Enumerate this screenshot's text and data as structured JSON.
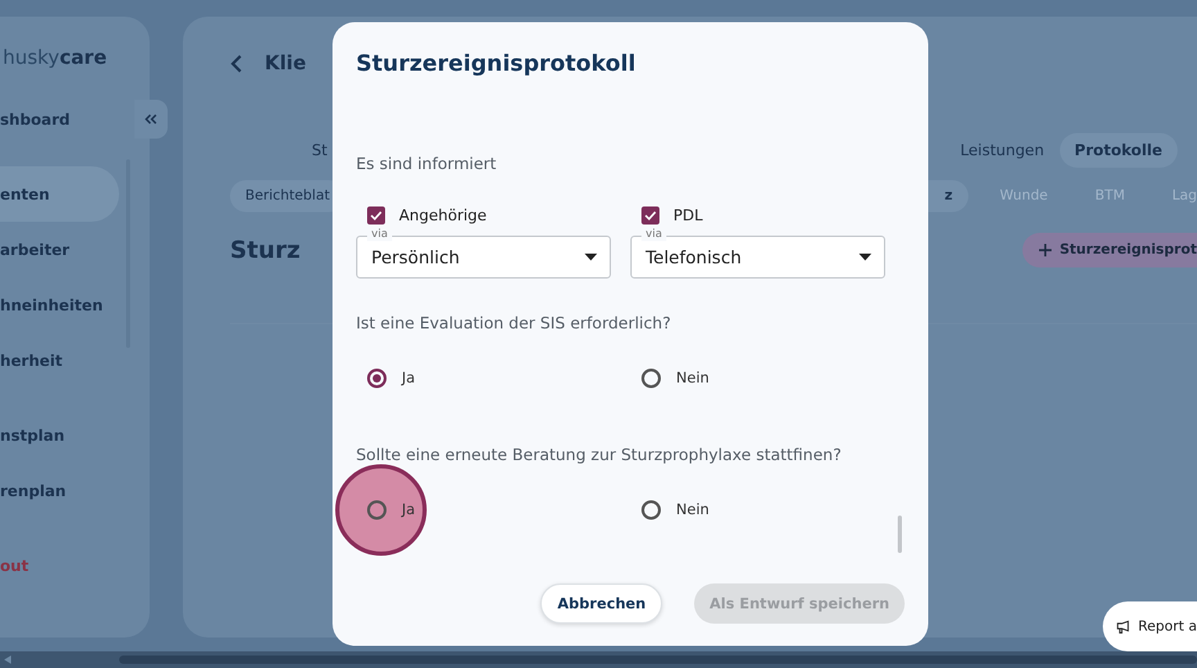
{
  "sidebar": {
    "logo": "husky**care**",
    "sections": [
      {
        "items": [
          {
            "label": "shboard",
            "selected": false,
            "kind": "nav"
          }
        ]
      },
      {
        "items": [
          {
            "label": "enten",
            "selected": true,
            "kind": "nav"
          },
          {
            "label": "arbeiter",
            "selected": false,
            "kind": "nav"
          },
          {
            "label": "hneinheiten",
            "selected": false,
            "kind": "nav"
          },
          {
            "label": "herheit",
            "selected": false,
            "kind": "nav"
          }
        ]
      },
      {
        "items": [
          {
            "label": "nstplan",
            "selected": false,
            "kind": "nav"
          },
          {
            "label": "renplan",
            "selected": false,
            "kind": "nav"
          }
        ]
      },
      {
        "items": [
          {
            "label": "out",
            "selected": false,
            "kind": "logout"
          }
        ]
      }
    ]
  },
  "main": {
    "title": "Klie",
    "tabs": [
      {
        "label": "St",
        "selected": false
      },
      {
        "label": "Leistungen",
        "selected": false
      },
      {
        "label": "Protokolle",
        "selected": true
      }
    ],
    "subtabs": [
      {
        "label": "Berichteblat",
        "selected": false
      },
      {
        "label": "z",
        "selected": true
      },
      {
        "label": "Wunde",
        "selected": false
      },
      {
        "label": "BTM",
        "selected": false
      },
      {
        "label": "Lag",
        "selected": false
      }
    ],
    "heading": "Sturz",
    "add_button": "Sturzereignisprot"
  },
  "modal": {
    "title": "Sturzereignisprotokoll",
    "section_label": "Es sind informiert",
    "contacts": [
      {
        "label": "Angehörige",
        "checked": true,
        "via_label": "via",
        "via_value": "Persönlich"
      },
      {
        "label": "PDL",
        "checked": true,
        "via_label": "via",
        "via_value": "Telefonisch"
      }
    ],
    "questions": [
      {
        "text": "Ist eine Evaluation der SIS erforderlich?",
        "options": [
          {
            "label": "Ja",
            "selected": true,
            "tapped": false
          },
          {
            "label": "Nein",
            "selected": false,
            "tapped": false
          }
        ]
      },
      {
        "text": "Sollte eine erneute Beratung zur Sturzprophylaxe stattfinen?",
        "options": [
          {
            "label": "Ja",
            "selected": false,
            "tapped": true
          },
          {
            "label": "Nein",
            "selected": false,
            "tapped": false
          }
        ]
      }
    ],
    "buttons": [
      {
        "label": "Abbrechen",
        "disabled": false
      },
      {
        "label": "Als Entwurf speichern",
        "disabled": true
      }
    ]
  },
  "report_button": "Report a"
}
